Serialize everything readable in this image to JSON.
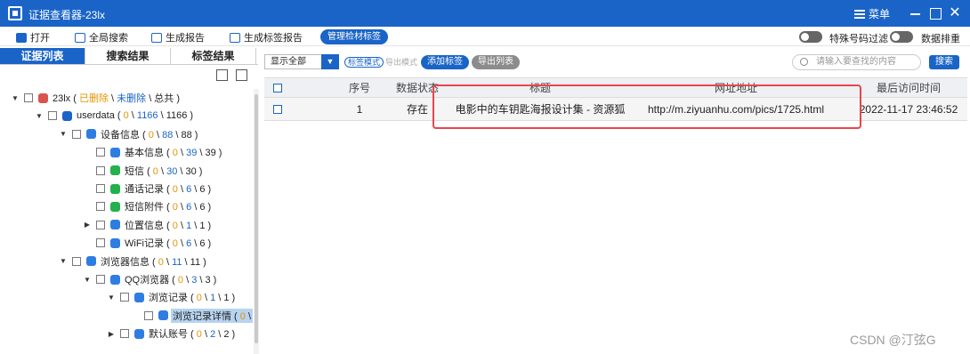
{
  "window": {
    "title": "证据查看器-23lx",
    "menu_label": "菜单",
    "close_glyph": "✕"
  },
  "toolbar": {
    "items": [
      {
        "label": "打开",
        "icon": "folder-open-icon"
      },
      {
        "label": "全局搜索",
        "icon": "search-doc-icon"
      },
      {
        "label": "生成报告",
        "icon": "report-icon"
      },
      {
        "label": "生成标签报告",
        "icon": "tag-icon"
      }
    ],
    "active_pill": "管理检材标签",
    "toggle1_label": "特殊号码过滤",
    "toggle2_label": "数据排重"
  },
  "left_tabs": [
    "证据列表",
    "搜索结果",
    "标签结果"
  ],
  "tree": [
    {
      "depth": 0,
      "arrow": "▼",
      "name": "23lx",
      "deleted_label": "已删除",
      "undeleted_label": "未删除",
      "total_label": "总共",
      "icon_color": "#d9534f"
    },
    {
      "depth": 1,
      "arrow": "▼",
      "name": "userdata",
      "deleted": "0",
      "undeleted": "1166",
      "total": "1166",
      "icon_color": "#1a64c8"
    },
    {
      "depth": 2,
      "arrow": "▼",
      "name": "设备信息",
      "deleted": "0",
      "undeleted": "88",
      "total": "88",
      "icon_color": "#2f7de1"
    },
    {
      "depth": 3,
      "arrow": "",
      "name": "基本信息",
      "deleted": "0",
      "undeleted": "39",
      "total": "39",
      "icon_color": "#2f7de1"
    },
    {
      "depth": 3,
      "arrow": "",
      "name": "短信",
      "deleted": "0",
      "undeleted": "30",
      "total": "30",
      "icon_color": "#22b14c"
    },
    {
      "depth": 3,
      "arrow": "",
      "name": "通话记录",
      "deleted": "0",
      "undeleted": "6",
      "total": "6",
      "icon_color": "#22b14c"
    },
    {
      "depth": 3,
      "arrow": "",
      "name": "短信附件",
      "deleted": "0",
      "undeleted": "6",
      "total": "6",
      "icon_color": "#22b14c"
    },
    {
      "depth": 3,
      "arrow": "▶",
      "name": "位置信息",
      "deleted": "0",
      "undeleted": "1",
      "total": "1",
      "icon_color": "#2f7de1"
    },
    {
      "depth": 3,
      "arrow": "",
      "name": "WiFi记录",
      "deleted": "0",
      "undeleted": "6",
      "total": "6",
      "icon_color": "#2f7de1"
    },
    {
      "depth": 2,
      "arrow": "▼",
      "name": "浏览器信息",
      "deleted": "0",
      "undeleted": "11",
      "total": "11",
      "icon_color": "#2f7de1"
    },
    {
      "depth": 3,
      "arrow": "▼",
      "name": "QQ浏览器",
      "deleted": "0",
      "undeleted": "3",
      "total": "3",
      "icon_color": "#2f7de1"
    },
    {
      "depth": 4,
      "arrow": "▼",
      "name": "浏览记录",
      "deleted": "0",
      "undeleted": "1",
      "total": "1",
      "icon_color": "#2f7de1"
    },
    {
      "depth": 5,
      "arrow": "",
      "name": "浏览记录详情",
      "deleted": "0",
      "undeleted": "",
      "total": "",
      "icon_color": "#2f7de1",
      "selected": true
    },
    {
      "depth": 4,
      "arrow": "▶",
      "name": "默认账号",
      "deleted": "0",
      "undeleted": "2",
      "total": "2",
      "icon_color": "#2f7de1"
    }
  ],
  "right_bar": {
    "select_value": "显示全部",
    "mode_on": "标签模式",
    "mode_off": "导出模式",
    "add_tag": "添加标签",
    "export_list": "导出列表",
    "search_placeholder": "请输入要查找的内容",
    "search_button": "搜索"
  },
  "table": {
    "columns": [
      "序号",
      "数据状态",
      "标题",
      "网址地址",
      "最后访问时间"
    ],
    "rows": [
      {
        "index": "1",
        "status": "存在",
        "title": "电影中的车钥匙海报设计集 - 资源狐",
        "url": "http://m.ziyuanhu.com/pics/1725.html",
        "time": "2022-11-17 23:46:52"
      }
    ]
  },
  "watermark": "CSDN @汀弦G",
  "colors": {
    "brand": "#1a64c8",
    "deleted": "#e69500",
    "highlight": "#e8454d"
  }
}
